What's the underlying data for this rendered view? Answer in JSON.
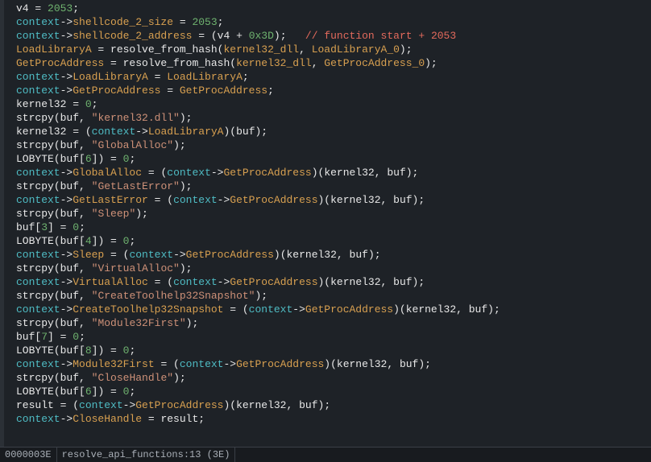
{
  "status": {
    "address": "0000003E",
    "location": "resolve_api_functions:13 (3E)"
  },
  "code": [
    [
      [
        "ident",
        "v4"
      ],
      [
        "punct",
        " = "
      ],
      [
        "num",
        "2053"
      ],
      [
        "punct",
        ";"
      ]
    ],
    [
      [
        "type",
        "context"
      ],
      [
        "punct",
        "->"
      ],
      [
        "field",
        "shellcode_2_size"
      ],
      [
        "punct",
        " = "
      ],
      [
        "num",
        "2053"
      ],
      [
        "punct",
        ";"
      ]
    ],
    [
      [
        "type",
        "context"
      ],
      [
        "punct",
        "->"
      ],
      [
        "field",
        "shellcode_2_address"
      ],
      [
        "punct",
        " = ("
      ],
      [
        "ident",
        "v4"
      ],
      [
        "punct",
        " + "
      ],
      [
        "num",
        "0x3D"
      ],
      [
        "punct",
        ");   "
      ],
      [
        "comment",
        "// function start + 2053"
      ]
    ],
    [
      [
        "global",
        "LoadLibraryA"
      ],
      [
        "punct",
        " = "
      ],
      [
        "ident",
        "resolve_from_hash"
      ],
      [
        "punct",
        "("
      ],
      [
        "global",
        "kernel32_dll"
      ],
      [
        "punct",
        ", "
      ],
      [
        "global",
        "LoadLibraryA_0"
      ],
      [
        "punct",
        ");"
      ]
    ],
    [
      [
        "global",
        "GetProcAddress"
      ],
      [
        "punct",
        " = "
      ],
      [
        "ident",
        "resolve_from_hash"
      ],
      [
        "punct",
        "("
      ],
      [
        "global",
        "kernel32_dll"
      ],
      [
        "punct",
        ", "
      ],
      [
        "global",
        "GetProcAddress_0"
      ],
      [
        "punct",
        ");"
      ]
    ],
    [
      [
        "type",
        "context"
      ],
      [
        "punct",
        "->"
      ],
      [
        "field",
        "LoadLibraryA"
      ],
      [
        "punct",
        " = "
      ],
      [
        "global",
        "LoadLibraryA"
      ],
      [
        "punct",
        ";"
      ]
    ],
    [
      [
        "type",
        "context"
      ],
      [
        "punct",
        "->"
      ],
      [
        "field",
        "GetProcAddress"
      ],
      [
        "punct",
        " = "
      ],
      [
        "global",
        "GetProcAddress"
      ],
      [
        "punct",
        ";"
      ]
    ],
    [
      [
        "ident",
        "kernel32"
      ],
      [
        "punct",
        " = "
      ],
      [
        "num",
        "0"
      ],
      [
        "punct",
        ";"
      ]
    ],
    [
      [
        "ident",
        "strcpy"
      ],
      [
        "punct",
        "("
      ],
      [
        "ident",
        "buf"
      ],
      [
        "punct",
        ", "
      ],
      [
        "str",
        "\"kernel32.dll\""
      ],
      [
        "punct",
        ");"
      ]
    ],
    [
      [
        "ident",
        "kernel32"
      ],
      [
        "punct",
        " = ("
      ],
      [
        "type",
        "context"
      ],
      [
        "punct",
        "->"
      ],
      [
        "field",
        "LoadLibraryA"
      ],
      [
        "punct",
        ")("
      ],
      [
        "ident",
        "buf"
      ],
      [
        "punct",
        ");"
      ]
    ],
    [
      [
        "ident",
        "strcpy"
      ],
      [
        "punct",
        "("
      ],
      [
        "ident",
        "buf"
      ],
      [
        "punct",
        ", "
      ],
      [
        "str",
        "\"GlobalAlloc\""
      ],
      [
        "punct",
        ");"
      ]
    ],
    [
      [
        "ident",
        "LOBYTE"
      ],
      [
        "punct",
        "("
      ],
      [
        "ident",
        "buf"
      ],
      [
        "punct",
        "["
      ],
      [
        "num",
        "6"
      ],
      [
        "punct",
        "]) = "
      ],
      [
        "num",
        "0"
      ],
      [
        "punct",
        ";"
      ]
    ],
    [
      [
        "type",
        "context"
      ],
      [
        "punct",
        "->"
      ],
      [
        "field",
        "GlobalAlloc"
      ],
      [
        "punct",
        " = ("
      ],
      [
        "type",
        "context"
      ],
      [
        "punct",
        "->"
      ],
      [
        "field",
        "GetProcAddress"
      ],
      [
        "punct",
        ")("
      ],
      [
        "ident",
        "kernel32"
      ],
      [
        "punct",
        ", "
      ],
      [
        "ident",
        "buf"
      ],
      [
        "punct",
        ");"
      ]
    ],
    [
      [
        "ident",
        "strcpy"
      ],
      [
        "punct",
        "("
      ],
      [
        "ident",
        "buf"
      ],
      [
        "punct",
        ", "
      ],
      [
        "str",
        "\"GetLastError\""
      ],
      [
        "punct",
        ");"
      ]
    ],
    [
      [
        "type",
        "context"
      ],
      [
        "punct",
        "->"
      ],
      [
        "field",
        "GetLastError"
      ],
      [
        "punct",
        " = ("
      ],
      [
        "type",
        "context"
      ],
      [
        "punct",
        "->"
      ],
      [
        "field",
        "GetProcAddress"
      ],
      [
        "punct",
        ")("
      ],
      [
        "ident",
        "kernel32"
      ],
      [
        "punct",
        ", "
      ],
      [
        "ident",
        "buf"
      ],
      [
        "punct",
        ");"
      ]
    ],
    [
      [
        "ident",
        "strcpy"
      ],
      [
        "punct",
        "("
      ],
      [
        "ident",
        "buf"
      ],
      [
        "punct",
        ", "
      ],
      [
        "str",
        "\"Sleep\""
      ],
      [
        "punct",
        ");"
      ]
    ],
    [
      [
        "ident",
        "buf"
      ],
      [
        "punct",
        "["
      ],
      [
        "num",
        "3"
      ],
      [
        "punct",
        "] = "
      ],
      [
        "num",
        "0"
      ],
      [
        "punct",
        ";"
      ]
    ],
    [
      [
        "ident",
        "LOBYTE"
      ],
      [
        "punct",
        "("
      ],
      [
        "ident",
        "buf"
      ],
      [
        "punct",
        "["
      ],
      [
        "num",
        "4"
      ],
      [
        "punct",
        "]) = "
      ],
      [
        "num",
        "0"
      ],
      [
        "punct",
        ";"
      ]
    ],
    [
      [
        "type",
        "context"
      ],
      [
        "punct",
        "->"
      ],
      [
        "field",
        "Sleep"
      ],
      [
        "punct",
        " = ("
      ],
      [
        "type",
        "context"
      ],
      [
        "punct",
        "->"
      ],
      [
        "field",
        "GetProcAddress"
      ],
      [
        "punct",
        ")("
      ],
      [
        "ident",
        "kernel32"
      ],
      [
        "punct",
        ", "
      ],
      [
        "ident",
        "buf"
      ],
      [
        "punct",
        ");"
      ]
    ],
    [
      [
        "ident",
        "strcpy"
      ],
      [
        "punct",
        "("
      ],
      [
        "ident",
        "buf"
      ],
      [
        "punct",
        ", "
      ],
      [
        "str",
        "\"VirtualAlloc\""
      ],
      [
        "punct",
        ");"
      ]
    ],
    [
      [
        "type",
        "context"
      ],
      [
        "punct",
        "->"
      ],
      [
        "field",
        "VirtualAlloc"
      ],
      [
        "punct",
        " = ("
      ],
      [
        "type",
        "context"
      ],
      [
        "punct",
        "->"
      ],
      [
        "field",
        "GetProcAddress"
      ],
      [
        "punct",
        ")("
      ],
      [
        "ident",
        "kernel32"
      ],
      [
        "punct",
        ", "
      ],
      [
        "ident",
        "buf"
      ],
      [
        "punct",
        ");"
      ]
    ],
    [
      [
        "ident",
        "strcpy"
      ],
      [
        "punct",
        "("
      ],
      [
        "ident",
        "buf"
      ],
      [
        "punct",
        ", "
      ],
      [
        "str",
        "\"CreateToolhelp32Snapshot\""
      ],
      [
        "punct",
        ");"
      ]
    ],
    [
      [
        "type",
        "context"
      ],
      [
        "punct",
        "->"
      ],
      [
        "field",
        "CreateToolhelp32Snapshot"
      ],
      [
        "punct",
        " = ("
      ],
      [
        "type",
        "context"
      ],
      [
        "punct",
        "->"
      ],
      [
        "field",
        "GetProcAddress"
      ],
      [
        "punct",
        ")("
      ],
      [
        "ident",
        "kernel32"
      ],
      [
        "punct",
        ", "
      ],
      [
        "ident",
        "buf"
      ],
      [
        "punct",
        ");"
      ]
    ],
    [
      [
        "ident",
        "strcpy"
      ],
      [
        "punct",
        "("
      ],
      [
        "ident",
        "buf"
      ],
      [
        "punct",
        ", "
      ],
      [
        "str",
        "\"Module32First\""
      ],
      [
        "punct",
        ");"
      ]
    ],
    [
      [
        "ident",
        "buf"
      ],
      [
        "punct",
        "["
      ],
      [
        "num",
        "7"
      ],
      [
        "punct",
        "] = "
      ],
      [
        "num",
        "0"
      ],
      [
        "punct",
        ";"
      ]
    ],
    [
      [
        "ident",
        "LOBYTE"
      ],
      [
        "punct",
        "("
      ],
      [
        "ident",
        "buf"
      ],
      [
        "punct",
        "["
      ],
      [
        "num",
        "8"
      ],
      [
        "punct",
        "]) = "
      ],
      [
        "num",
        "0"
      ],
      [
        "punct",
        ";"
      ]
    ],
    [
      [
        "type",
        "context"
      ],
      [
        "punct",
        "->"
      ],
      [
        "field",
        "Module32First"
      ],
      [
        "punct",
        " = ("
      ],
      [
        "type",
        "context"
      ],
      [
        "punct",
        "->"
      ],
      [
        "field",
        "GetProcAddress"
      ],
      [
        "punct",
        ")("
      ],
      [
        "ident",
        "kernel32"
      ],
      [
        "punct",
        ", "
      ],
      [
        "ident",
        "buf"
      ],
      [
        "punct",
        ");"
      ]
    ],
    [
      [
        "ident",
        "strcpy"
      ],
      [
        "punct",
        "("
      ],
      [
        "ident",
        "buf"
      ],
      [
        "punct",
        ", "
      ],
      [
        "str",
        "\"CloseHandle\""
      ],
      [
        "punct",
        ");"
      ]
    ],
    [
      [
        "ident",
        "LOBYTE"
      ],
      [
        "punct",
        "("
      ],
      [
        "ident",
        "buf"
      ],
      [
        "punct",
        "["
      ],
      [
        "num",
        "6"
      ],
      [
        "punct",
        "]) = "
      ],
      [
        "num",
        "0"
      ],
      [
        "punct",
        ";"
      ]
    ],
    [
      [
        "ident",
        "result"
      ],
      [
        "punct",
        " = ("
      ],
      [
        "type",
        "context"
      ],
      [
        "punct",
        "->"
      ],
      [
        "field",
        "GetProcAddress"
      ],
      [
        "punct",
        ")("
      ],
      [
        "ident",
        "kernel32"
      ],
      [
        "punct",
        ", "
      ],
      [
        "ident",
        "buf"
      ],
      [
        "punct",
        ");"
      ]
    ],
    [
      [
        "type",
        "context"
      ],
      [
        "punct",
        "->"
      ],
      [
        "field",
        "CloseHandle"
      ],
      [
        "punct",
        " = "
      ],
      [
        "ident",
        "result"
      ],
      [
        "punct",
        ";"
      ]
    ]
  ]
}
